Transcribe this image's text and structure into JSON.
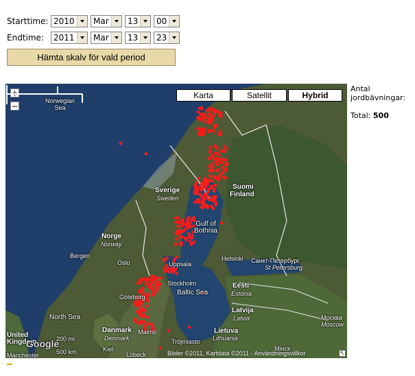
{
  "form": {
    "start_label": "Starttime:",
    "start": {
      "year": "2010",
      "month": "Mar",
      "day": "13",
      "hour": "00"
    },
    "end_label": "Endtime:",
    "end": {
      "year": "2011",
      "month": "Mar",
      "day": "13",
      "hour": "23"
    },
    "fetch_button": "Hämta skalv för vald period"
  },
  "map": {
    "zoom_in": "+",
    "zoom_out": "−",
    "types": [
      {
        "label": "Karta",
        "active": false
      },
      {
        "label": "Satellit",
        "active": false
      },
      {
        "label": "Hybrid",
        "active": true
      }
    ],
    "labels": {
      "norwegian_sea": "Norwegian\nSea",
      "sverige": "Sverige",
      "sweden": "Sweden",
      "suomi": "Suomi",
      "finland": "Finland",
      "norge": "Norge",
      "norway": "Norway",
      "gulf_of_bothnia": "Gulf of\nBothnia",
      "bergen": "Bergen",
      "oslo": "Oslo",
      "uppsala": "Uppsala",
      "helsinki": "Helsinki",
      "st_petersburg_ru": "Санкт-Петербург",
      "st_petersburg": "St Petersburg",
      "stockholm": "Stockholm",
      "eesti": "Eesti",
      "estonia": "Estonia",
      "goteborg": "Göteborg",
      "baltic_sea": "Baltic Sea",
      "latvija": "Latvija",
      "latvia": "Latvia",
      "north_sea": "North Sea",
      "danmark": "Danmark",
      "denmark": "Denmark",
      "malmo": "Malmö",
      "lietuva": "Lietuva",
      "lithuania": "Lithuania",
      "united_kingdom": "United\nKingdom",
      "moskva": "Москва",
      "moscow": "Moscow",
      "manchester": "Manchester",
      "kiel": "Kiel",
      "lubeck": "Lübeck",
      "trojmiasto": "Trójmiasto",
      "minsk": "Мінск",
      "google": "Google"
    },
    "scale_mi": "200 mi",
    "scale_km": "500 km",
    "credit": "Bilder ©2011, Kartdata ©2011 - Användningsvillkor"
  },
  "side": {
    "count_label": "Antal\njordbävningar:",
    "total_label": "Total:",
    "total_value": "500"
  },
  "colors": {
    "marker": "#ff1a1a",
    "button_bg": "#ead9a8",
    "sea": "#1f3f6a"
  }
}
